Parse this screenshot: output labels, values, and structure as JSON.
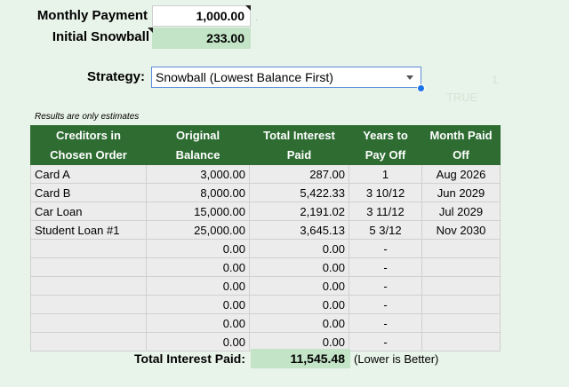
{
  "inputs": {
    "monthly_payment_label": "Monthly Payment",
    "monthly_payment_value": "1,000.00",
    "initial_snowball_label": "Initial Snowball",
    "initial_snowball_value": "233.00"
  },
  "strategy": {
    "label": "Strategy:",
    "selected": "Snowball (Lowest Balance First)"
  },
  "ghost": {
    "top_right": "1",
    "true_text": "TRUE"
  },
  "note": "Results are only estimates",
  "table": {
    "headers": [
      [
        "Creditors in",
        "Chosen Order"
      ],
      [
        "Original",
        "Balance"
      ],
      [
        "Total Interest",
        "Paid"
      ],
      [
        "Years to",
        "Pay Off"
      ],
      [
        "Month Paid",
        "Off"
      ]
    ],
    "rows": [
      [
        "Card A",
        "3,000.00",
        "287.00",
        "1",
        "Aug 2026"
      ],
      [
        "Card B",
        "8,000.00",
        "5,422.33",
        "3  10/12",
        "Jun 2029"
      ],
      [
        "Car Loan",
        "15,000.00",
        "2,191.02",
        "3  11/12",
        "Jul 2029"
      ],
      [
        "Student Loan #1",
        "25,000.00",
        "3,645.13",
        "5  3/12",
        "Nov 2030"
      ],
      [
        "",
        "0.00",
        "0.00",
        "-",
        ""
      ],
      [
        "",
        "0.00",
        "0.00",
        "-",
        ""
      ],
      [
        "",
        "0.00",
        "0.00",
        "-",
        ""
      ],
      [
        "",
        "0.00",
        "0.00",
        "-",
        ""
      ],
      [
        "",
        "0.00",
        "0.00",
        "-",
        ""
      ],
      [
        "",
        "0.00",
        "0.00",
        "-",
        ""
      ]
    ]
  },
  "total": {
    "label": "Total Interest Paid:",
    "value": "11,545.48",
    "note": "(Lower is Better)"
  },
  "colors": {
    "header_green": "#2e6c32",
    "input_green": "#c3e4c6",
    "background": "#e8f3e9"
  }
}
